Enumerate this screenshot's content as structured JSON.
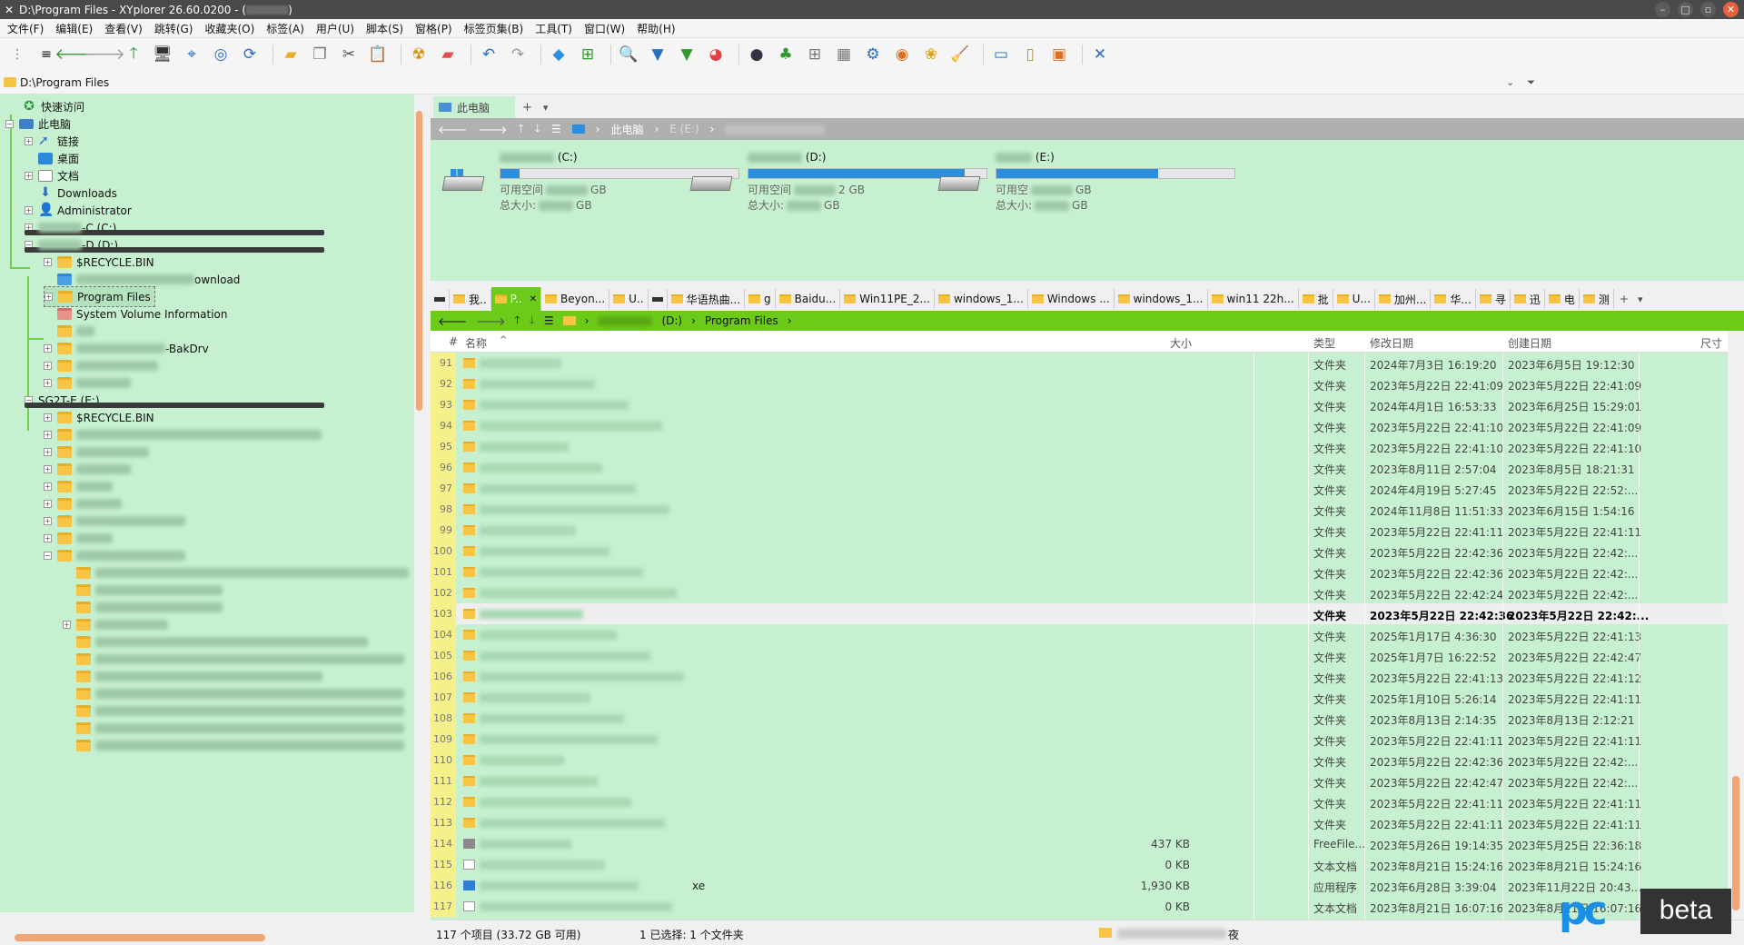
{
  "window": {
    "title_prefix": "D:\\Program Files - XYplorer 26.60.0200 - (",
    "title_suffix": ")"
  },
  "menu": [
    "文件(F)",
    "编辑(E)",
    "查看(V)",
    "跳转(G)",
    "收藏夹(O)",
    "标签(A)",
    "用户(U)",
    "脚本(S)",
    "窗格(P)",
    "标签页集(B)",
    "工具(T)",
    "窗口(W)",
    "帮助(H)"
  ],
  "address": {
    "path": "D:\\Program Files"
  },
  "tree": {
    "quick_access": "快速访问",
    "this_pc": "此电脑",
    "links": "链接",
    "desktop": "桌面",
    "documents": "文档",
    "downloads": "Downloads",
    "administrator": "Administrator",
    "drive_c": "-C (C:)",
    "drive_d": "-D (D:)",
    "recycle_d": "$RECYCLE.BIN",
    "download_folder": "ownload",
    "program_files": "Program Files",
    "system_volume": "System Volume Information",
    "bakdrv": "-BakDrv",
    "drive_e": "SG2T-E (E:)",
    "recycle_e": "$RECYCLE.BIN"
  },
  "pane_tab": {
    "label": "此电脑",
    "add": "+",
    "menu": "▾"
  },
  "nav1": {
    "crumb_pc": "此电脑",
    "crumb_e": "E (E:)"
  },
  "drives": [
    {
      "letter": "(C:)",
      "free_label": "可用空间",
      "free_unit": "GB",
      "total_label": "总大小:",
      "total_unit": "GB",
      "used_fraction": 0.08
    },
    {
      "letter": "(D:)",
      "free_label": "可用空间",
      "free_unit": "2 GB",
      "total_label": "总大小:",
      "total_unit": "GB",
      "used_fraction": 0.91
    },
    {
      "letter": "(E:)",
      "free_label": "可用空",
      "free_unit": "GB",
      "total_label": "总大小:",
      "total_unit": "GB",
      "used_fraction": 0.68
    }
  ],
  "file_tabs": [
    "我..",
    "P..",
    "Beyon...",
    "U..",
    "华语热曲...",
    "g",
    "Baidu...",
    "Win11PE_2...",
    "windows_1...",
    "Windows ...",
    "windows_1...",
    "win11 22h...",
    "批",
    "U...",
    "加州...",
    "华...",
    "寻",
    "迅",
    "电",
    "测"
  ],
  "nav2": {
    "drive": "(D:)",
    "folder": "Program Files"
  },
  "columns": {
    "num": "#",
    "name": "名称",
    "size": "大小",
    "type": "类型",
    "modified": "修改日期",
    "created": "创建日期",
    "dims": "尺寸"
  },
  "rows": [
    {
      "n": "91",
      "icon": "folder",
      "size": "",
      "type": "文件夹",
      "mod": "2024年7月3日 16:19:20",
      "cre": "2023年6月5日 19:12:30"
    },
    {
      "n": "92",
      "icon": "folder",
      "size": "",
      "type": "文件夹",
      "mod": "2023年5月22日 22:41:09",
      "cre": "2023年5月22日 22:41:09"
    },
    {
      "n": "93",
      "icon": "folder",
      "size": "",
      "type": "文件夹",
      "mod": "2024年4月1日 16:53:33",
      "cre": "2023年6月25日 15:29:01"
    },
    {
      "n": "94",
      "icon": "folder",
      "size": "",
      "type": "文件夹",
      "mod": "2023年5月22日 22:41:10",
      "cre": "2023年5月22日 22:41:09"
    },
    {
      "n": "95",
      "icon": "folder",
      "size": "",
      "type": "文件夹",
      "mod": "2023年5月22日 22:41:10",
      "cre": "2023年5月22日 22:41:10"
    },
    {
      "n": "96",
      "icon": "folder",
      "size": "",
      "type": "文件夹",
      "mod": "2023年8月11日 2:57:04",
      "cre": "2023年8月5日 18:21:31"
    },
    {
      "n": "97",
      "icon": "folder",
      "size": "",
      "type": "文件夹",
      "mod": "2024年4月19日 5:27:45",
      "cre": "2023年5月22日 22:52:..."
    },
    {
      "n": "98",
      "icon": "folder",
      "size": "",
      "type": "文件夹",
      "mod": "2024年11月8日 11:51:33",
      "cre": "2023年6月15日 1:54:16"
    },
    {
      "n": "99",
      "icon": "folder",
      "size": "",
      "type": "文件夹",
      "mod": "2023年5月22日 22:41:11",
      "cre": "2023年5月22日 22:41:11"
    },
    {
      "n": "100",
      "icon": "folder",
      "size": "",
      "type": "文件夹",
      "mod": "2023年5月22日 22:42:36",
      "cre": "2023年5月22日 22:42:..."
    },
    {
      "n": "101",
      "icon": "folder",
      "size": "",
      "type": "文件夹",
      "mod": "2023年5月22日 22:42:36",
      "cre": "2023年5月22日 22:42:..."
    },
    {
      "n": "102",
      "icon": "folder",
      "size": "",
      "type": "文件夹",
      "mod": "2023年5月22日 22:42:24",
      "cre": "2023年5月22日 22:42:..."
    },
    {
      "n": "103",
      "icon": "folder",
      "size": "",
      "type": "文件夹",
      "mod": "2023年5月22日 22:42:36",
      "cre": "2023年5月22日 22:42:...",
      "selected": true
    },
    {
      "n": "104",
      "icon": "folder",
      "size": "",
      "type": "文件夹",
      "mod": "2025年1月17日 4:36:30",
      "cre": "2023年5月22日 22:41:13"
    },
    {
      "n": "105",
      "icon": "folder",
      "size": "",
      "type": "文件夹",
      "mod": "2025年1月7日 16:22:52",
      "cre": "2023年5月22日 22:42:47"
    },
    {
      "n": "106",
      "icon": "folder",
      "size": "",
      "type": "文件夹",
      "mod": "2023年5月22日 22:41:13",
      "cre": "2023年5月22日 22:41:12"
    },
    {
      "n": "107",
      "icon": "folder",
      "size": "",
      "type": "文件夹",
      "mod": "2025年1月10日 5:26:14",
      "cre": "2023年5月22日 22:41:11"
    },
    {
      "n": "108",
      "icon": "folder",
      "size": "",
      "type": "文件夹",
      "mod": "2023年8月13日 2:14:35",
      "cre": "2023年8月13日 2:12:21"
    },
    {
      "n": "109",
      "icon": "folder",
      "size": "",
      "type": "文件夹",
      "mod": "2023年5月22日 22:41:11",
      "cre": "2023年5月22日 22:41:11"
    },
    {
      "n": "110",
      "icon": "folder",
      "size": "",
      "type": "文件夹",
      "mod": "2023年5月22日 22:42:36",
      "cre": "2023年5月22日 22:42:..."
    },
    {
      "n": "111",
      "icon": "folder",
      "size": "",
      "type": "文件夹",
      "mod": "2023年5月22日 22:42:47",
      "cre": "2023年5月22日 22:42:..."
    },
    {
      "n": "112",
      "icon": "folder",
      "size": "",
      "type": "文件夹",
      "mod": "2023年5月22日 22:41:11",
      "cre": "2023年5月22日 22:41:11"
    },
    {
      "n": "113",
      "icon": "folder",
      "size": "",
      "type": "文件夹",
      "mod": "2023年5月22日 22:41:11",
      "cre": "2023年5月22日 22:41:11"
    },
    {
      "n": "114",
      "icon": "exe",
      "size": "437 KB",
      "type": "FreeFile...",
      "mod": "2023年5月26日 19:14:35",
      "cre": "2023年5月25日 22:36:18"
    },
    {
      "n": "115",
      "icon": "doc",
      "size": "0 KB",
      "type": "文本文档",
      "mod": "2023年8月21日 15:24:16",
      "cre": "2023年8月21日 15:24:16"
    },
    {
      "n": "116",
      "icon": "app",
      "size": "1,930 KB",
      "type": "应用程序",
      "mod": "2023年6月28日 3:39:04",
      "cre": "2023年11月22日 20:43...",
      "name_tail": "xe"
    },
    {
      "n": "117",
      "icon": "doc",
      "size": "0 KB",
      "type": "文本文档",
      "mod": "2023年8月21日 16:07:16",
      "cre": "2023年8月21日 16:07:16"
    }
  ],
  "status": {
    "count": "117 个项目 (33.72 GB 可用)",
    "selection": "1 已选择: 1 个文件夹",
    "right_tail": "夜"
  },
  "watermark": {
    "pc": "pc",
    "beta": "beta"
  },
  "colors": {
    "pane_bg": "#c6f0cf",
    "accent_green": "#6ccb18",
    "scroll_thumb": "#f0a576",
    "drive_bar": "#2b8fde"
  }
}
